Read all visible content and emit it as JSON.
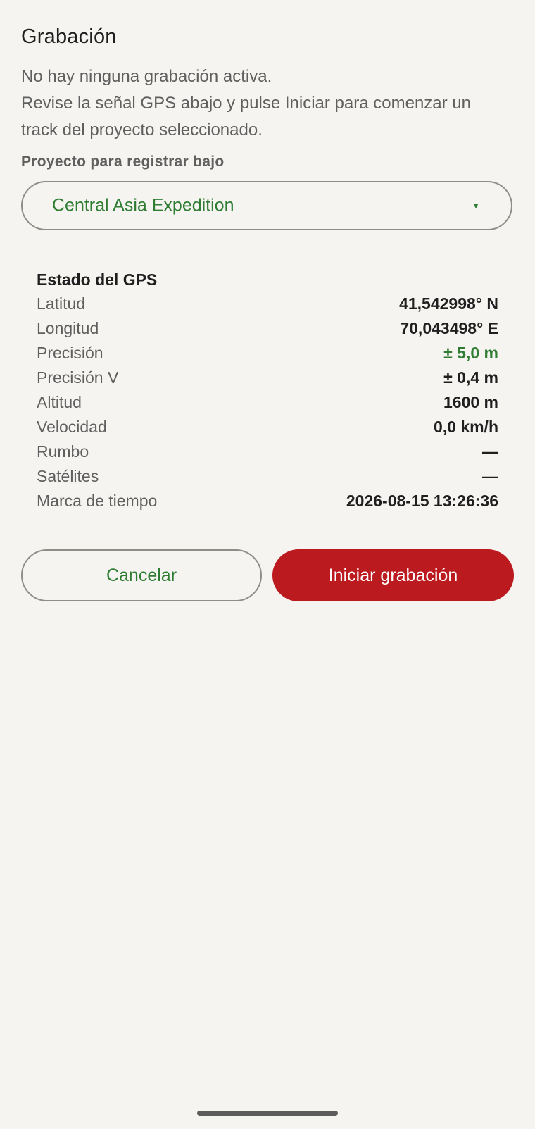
{
  "header": {
    "title": "Grabación"
  },
  "description": {
    "line1": "No hay ninguna grabación activa.",
    "line2": "Revise la señal GPS abajo y pulse Iniciar para comenzar un",
    "line3": "track del proyecto seleccionado."
  },
  "project": {
    "label": "Proyecto para registrar bajo",
    "selected": "Central Asia Expedition",
    "caret": "▼"
  },
  "gps": {
    "title": "Estado del GPS",
    "rows": [
      {
        "label": "Latitud",
        "value": "41,542998° N"
      },
      {
        "label": "Longitud",
        "value": "70,043498° E"
      },
      {
        "label": "Precisión",
        "value": "± 5,0 m"
      },
      {
        "label": "Precisión V",
        "value": "± 0,4 m"
      },
      {
        "label": "Altitud",
        "value": "1600 m"
      },
      {
        "label": "Velocidad",
        "value": "0,0 km/h"
      },
      {
        "label": "Rumbo",
        "value": "—"
      },
      {
        "label": "Satélites",
        "value": "—"
      },
      {
        "label": "Marca de tiempo",
        "value": "2026-08-15 13:26:36"
      }
    ]
  },
  "actions": {
    "cancel_label": "Cancelar",
    "start_label": "Iniciar grabación"
  },
  "colors": {
    "accent_green": "#2e7d32",
    "primary_red": "#bb1a1e",
    "background": "#f5f4f1"
  }
}
